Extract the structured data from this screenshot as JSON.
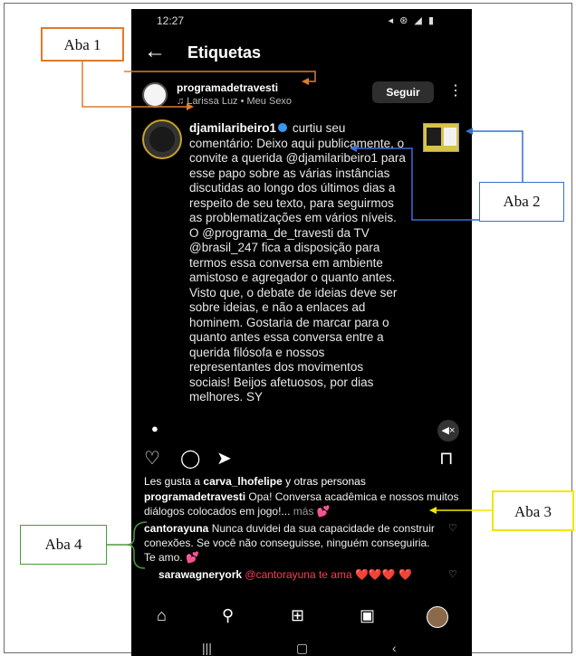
{
  "status_bar": {
    "time": "12:27",
    "icons": "◂ ⊛ ◢ ▮"
  },
  "header": {
    "title": "Etiquetas"
  },
  "post": {
    "username": "programadetravesti",
    "audio": "♫ Larissa Luz • Meu Sexo",
    "follow_label": "Seguir"
  },
  "notification": {
    "username": "djamilaribeiro1",
    "text": "curtiu seu comentário: Deixo aqui publicamente, o convite a querida @djamilaribeiro1 para esse papo sobre as várias instâncias discutidas ao longo dos últimos dias a respeito de seu texto, para seguirmos as problematizações em vários níveis. O @programa_de_travesti da TV @brasil_247 fica a disposição para termos essa conversa em ambiente amistoso e agregador o quanto antes. Visto que, o debate de ideias deve ser sobre ideias, e não a enlaces ad hominem. Gostaria de marcar para o quanto antes essa conversa entre a querida filósofa e nossos representantes dos movimentos sociais! Beijos afetuosos, por dias melhores. SY"
  },
  "likes": {
    "prefix": "Les gusta a",
    "user": "carva_lhofelipe",
    "suffix": "y otras personas"
  },
  "caption": {
    "username": "programadetravesti",
    "text": "Opa! Conversa acadêmica e nossos muitos diálogos colocados em jogo!...",
    "more": "más"
  },
  "comments": [
    {
      "username": "cantorayuna",
      "text": "Nunca duvidei da sua capacidade de construir conexões. Se você não conseguisse, ninguém conseguiria. Te amo."
    },
    {
      "username": "sarawagneryork",
      "text": "@cantorayuna te ama ❤️❤️❤️ ❤️"
    }
  ],
  "annotations": {
    "aba1": "Aba 1",
    "aba2": "Aba 2",
    "aba3": "Aba 3",
    "aba4": "Aba 4"
  },
  "colors": {
    "aba1": "#e07b2a",
    "aba2": "#3a6fd1",
    "aba3": "#f2e600",
    "aba4": "#4c9a3c"
  }
}
